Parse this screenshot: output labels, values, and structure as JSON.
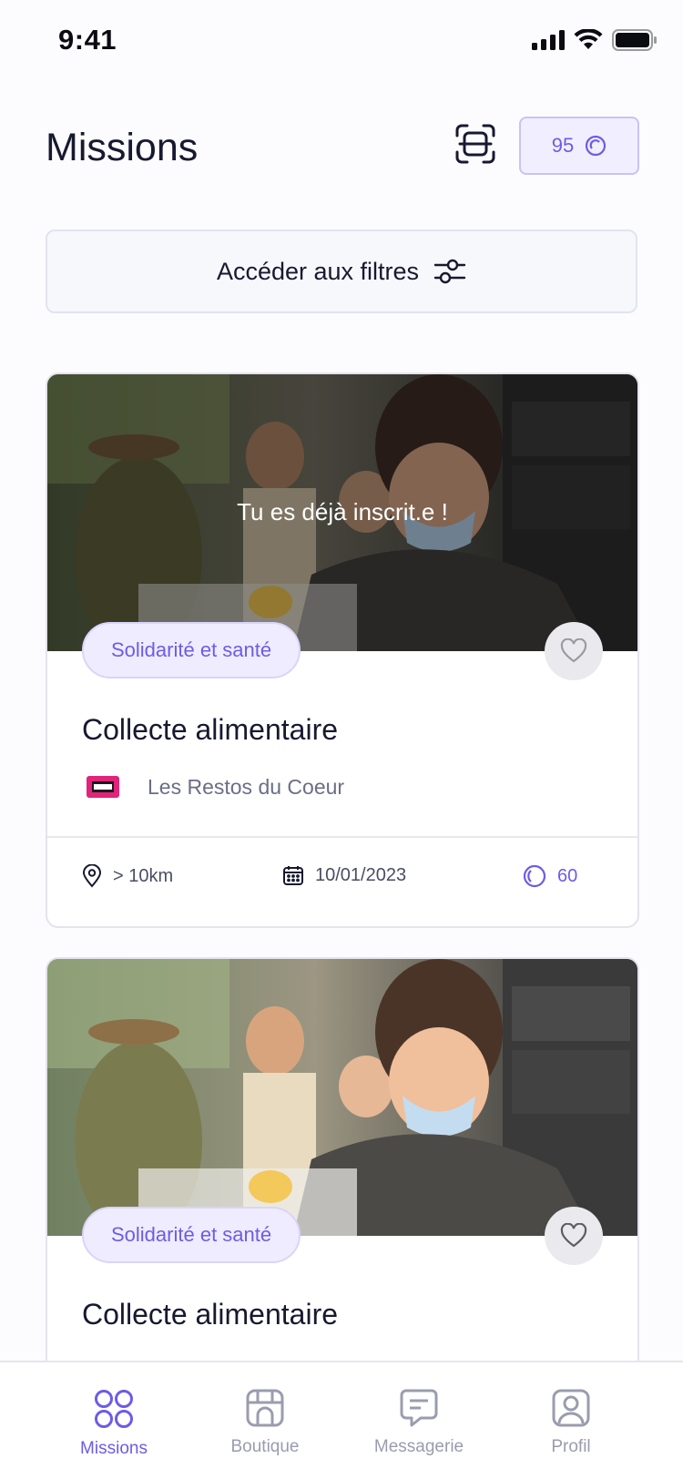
{
  "status_bar": {
    "time": "9:41"
  },
  "header": {
    "title": "Missions",
    "points_value": "95"
  },
  "filters": {
    "label": "Accéder aux filtres"
  },
  "missions": [
    {
      "overlay_text": "Tu es déjà inscrit.e !",
      "category": "Solidarité et santé",
      "title": "Collecte alimentaire",
      "organization": "Les Restos du Coeur",
      "distance": "> 10km",
      "date": "10/01/2023",
      "points": "60"
    },
    {
      "category": "Solidarité et santé",
      "title": "Collecte alimentaire"
    }
  ],
  "tabbar": {
    "items": [
      {
        "label": "Missions",
        "icon": "missions-grid-icon",
        "active": true
      },
      {
        "label": "Boutique",
        "icon": "shop-icon",
        "active": false
      },
      {
        "label": "Messagerie",
        "icon": "message-icon",
        "active": false
      },
      {
        "label": "Profil",
        "icon": "profile-icon",
        "active": false
      }
    ]
  },
  "colors": {
    "accent": "#6c5ce7",
    "text_primary": "#171930",
    "text_muted": "#9a9cae",
    "badge_bg": "#efecff"
  }
}
